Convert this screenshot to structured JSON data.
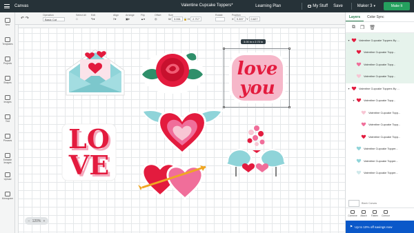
{
  "topbar": {
    "section": "Canvas",
    "title": "Valentine Cupcake Toppers*",
    "learning_plan": "Learning Plan",
    "my_stuff": "My Stuff",
    "save": "Save",
    "machine": "Maker 3",
    "make_it": "Make It"
  },
  "toolbar": {
    "operation_label": "Operation",
    "operation_value": "Basic Cut",
    "select_all": "Select All",
    "edit": "Edit",
    "align": "Align",
    "arrange": "Arrange",
    "flip": "Flip",
    "offset": "Offset",
    "size_label": "Size",
    "w_value": "3.061",
    "h_value": "2.717",
    "rotate_label": "Rotate",
    "position_label": "Position",
    "x_value": "9.397",
    "y_value": "0.627"
  },
  "left_nav": [
    {
      "label": "New",
      "icon": "plus-icon"
    },
    {
      "label": "Templates",
      "icon": "shirt-icon"
    },
    {
      "label": "Projects",
      "icon": "grid-icon"
    },
    {
      "label": "Shapes",
      "icon": "shapes-icon"
    },
    {
      "label": "Images",
      "icon": "lightbulb-icon"
    },
    {
      "label": "Text",
      "icon": "text-icon"
    },
    {
      "label": "Phrases",
      "icon": "quote-icon"
    },
    {
      "label": "Editable Images",
      "icon": "image-edit-icon"
    },
    {
      "label": "Upload",
      "icon": "upload-icon"
    },
    {
      "label": "Monogram",
      "icon": "monogram-icon"
    }
  ],
  "canvas": {
    "selection_size": "3.00 in x 2.72 in",
    "love_you_text": [
      "love",
      "you"
    ],
    "love_text": [
      "LO",
      "VE"
    ],
    "zoom": "120%",
    "accent": "#e31b3e",
    "pink": "#f06e9a",
    "teal": "#8fd4d9"
  },
  "right_panel": {
    "tabs": [
      "Layers",
      "Color Sync"
    ],
    "layer_tools": [
      "group-icon",
      "duplicate-icon",
      "delete-icon"
    ],
    "layers": [
      {
        "name": "Valentine Cupcake Toppers By ...",
        "level": 0,
        "selected": true,
        "color": "#e31b3e"
      },
      {
        "name": "Valentine Cupcake Topp...",
        "level": 1,
        "selected": true,
        "color": "#e31b3e"
      },
      {
        "name": "Valentine Cupcake Topp...",
        "level": 1,
        "selected": true,
        "color": "#f06e9a"
      },
      {
        "name": "Valentine Cupcake Topp...",
        "level": 1,
        "selected": true,
        "color": "#f8c6d4"
      },
      {
        "name": "Valentine Cupcake Toppers By ...",
        "level": 0,
        "selected": false,
        "color": "#e31b3e"
      },
      {
        "name": "Valentine Cupcake Topp...",
        "level": 1,
        "selected": false,
        "color": "#e31b3e"
      },
      {
        "name": "Valentine Cupcake Topp...",
        "level": 2,
        "selected": false,
        "color": "#f8c6d4"
      },
      {
        "name": "Valentine Cupcake Topp...",
        "level": 2,
        "selected": false,
        "color": "#f06e9a"
      },
      {
        "name": "Valentine Cupcake Topp...",
        "level": 2,
        "selected": false,
        "color": "#e31b3e"
      },
      {
        "name": "Valentine Cupcake Topper...",
        "level": 1,
        "selected": false,
        "color": "#8fd4d9"
      },
      {
        "name": "Valentine Cupcake Topper...",
        "level": 1,
        "selected": false,
        "color": "#8fd4d9"
      },
      {
        "name": "Valentine Cupcake Topper...",
        "level": 1,
        "selected": false,
        "color": "#cfe8ea"
      }
    ],
    "blank_canvas": "Blank Canvas",
    "bottom_tools": [
      "Combine",
      "Attach",
      "Flatten",
      "Contour"
    ],
    "promo": "Up to 10% off savings now"
  }
}
